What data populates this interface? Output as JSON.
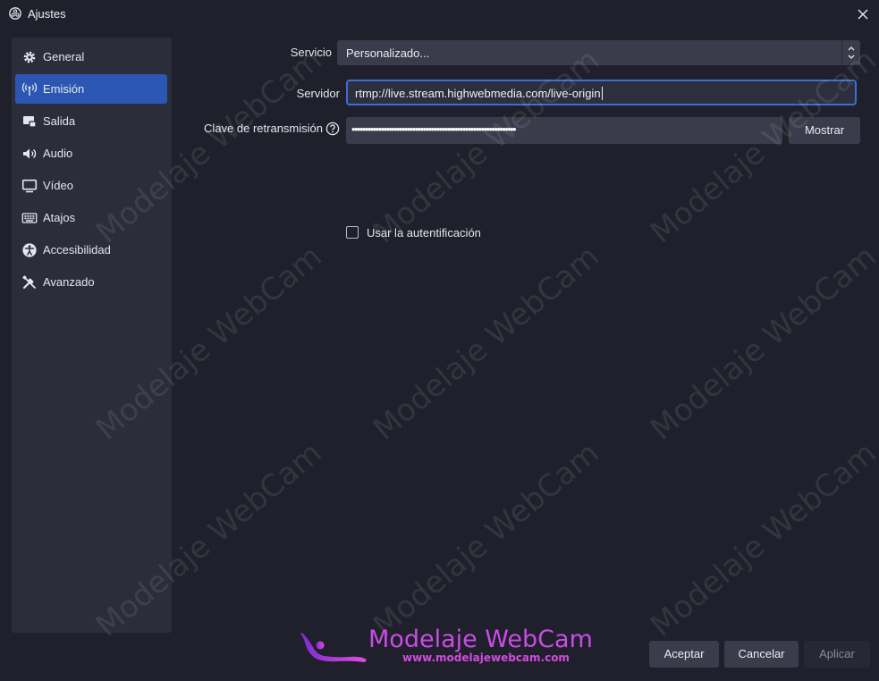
{
  "window": {
    "title": "Ajustes"
  },
  "sidebar": {
    "items": [
      {
        "label": "General",
        "icon": "gear-icon",
        "active": false
      },
      {
        "label": "Emisión",
        "icon": "broadcast-icon",
        "active": true
      },
      {
        "label": "Salida",
        "icon": "output-icon",
        "active": false
      },
      {
        "label": "Audio",
        "icon": "speaker-icon",
        "active": false
      },
      {
        "label": "Vídeo",
        "icon": "monitor-icon",
        "active": false
      },
      {
        "label": "Atajos",
        "icon": "keyboard-icon",
        "active": false
      },
      {
        "label": "Accesibilidad",
        "icon": "accessibility-icon",
        "active": false
      },
      {
        "label": "Avanzado",
        "icon": "tools-icon",
        "active": false
      }
    ]
  },
  "form": {
    "service_label": "Servicio",
    "service_value": "Personalizado...",
    "server_label": "Servidor",
    "server_value": "rtmp://live.stream.highwebmedia.com/live-origin",
    "key_label": "Clave de retransmisión",
    "key_value": "••••••••••••••••••••••••••••••••••••••••••••••••••••••••••••••",
    "show_button": "Mostrar",
    "auth_label": "Usar la autentificación",
    "auth_checked": false
  },
  "footer": {
    "accept": "Aceptar",
    "cancel": "Cancelar",
    "apply": "Aplicar"
  },
  "watermark": {
    "text": "Modelaje WebCam",
    "url": "www.modelajewebcam.com"
  },
  "colors": {
    "accent": "#2b57b3",
    "focus_border": "#3b6fd6",
    "background": "#1f202b",
    "panel": "#2b2d3b",
    "control": "#3a3c4c"
  }
}
